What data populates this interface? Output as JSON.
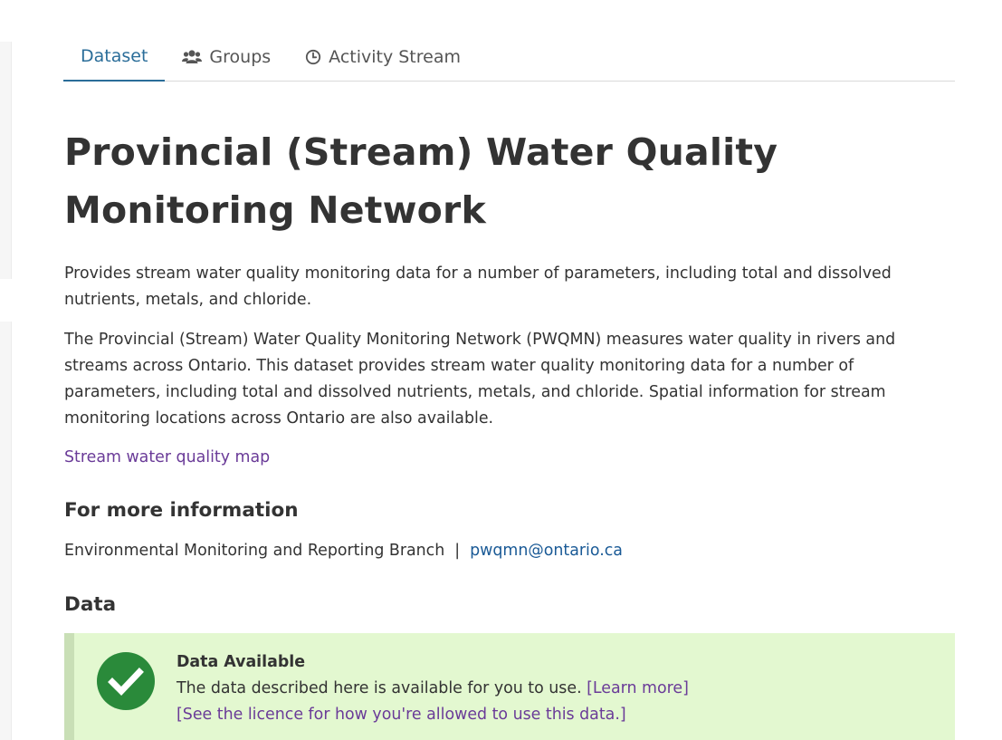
{
  "tabs": [
    {
      "label": "Dataset",
      "icon": "",
      "active": true
    },
    {
      "label": "Groups",
      "icon": "users-icon",
      "active": false
    },
    {
      "label": "Activity Stream",
      "icon": "clock-icon",
      "active": false
    }
  ],
  "page": {
    "title": "Provincial (Stream) Water Quality Monitoring Network",
    "summary": "Provides stream water quality monitoring data for a number of parameters, including total and dissolved nutrients, metals, and chloride.",
    "description": "The Provincial (Stream) Water Quality Monitoring Network (PWQMN) measures water quality in rivers and streams across Ontario. This dataset provides stream water quality monitoring data for a number of parameters, including total and dissolved nutrients, metals, and chloride. Spatial information for stream monitoring locations across Ontario are also available.",
    "map_link": "Stream water quality map"
  },
  "more_info": {
    "heading": "For more information",
    "branch": "Environmental Monitoring and Reporting Branch",
    "separator": "|",
    "email": "pwqmn@ontario.ca"
  },
  "data_section": {
    "heading": "Data",
    "callout": {
      "title": "Data Available",
      "text": "The data described here is available for you to use.",
      "learn_more": "[Learn more]",
      "licence_link": "[See the licence for how you're allowed to use this data.]",
      "icon": "checkmark-circle-icon"
    }
  },
  "colors": {
    "accent": "#2a6d99",
    "link_visited": "#6a3b98",
    "link": "#1a5a96",
    "callout_bg": "#e3f8d0",
    "success": "#2a8a3a"
  }
}
